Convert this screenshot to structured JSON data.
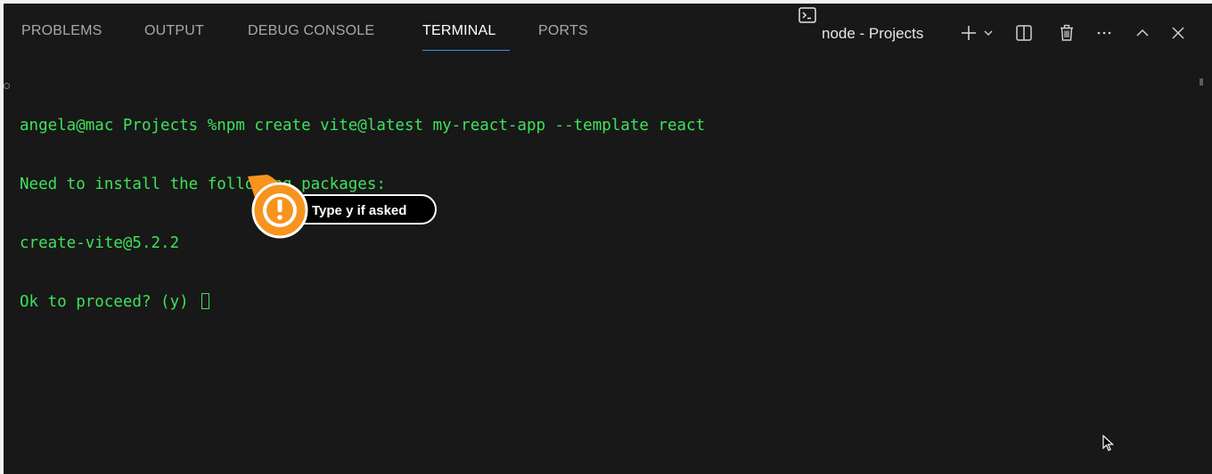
{
  "tabs": [
    {
      "label": "PROBLEMS",
      "active": false
    },
    {
      "label": "OUTPUT",
      "active": false
    },
    {
      "label": "DEBUG CONSOLE",
      "active": false
    },
    {
      "label": "TERMINAL",
      "active": true
    },
    {
      "label": "PORTS",
      "active": false
    }
  ],
  "toolbar": {
    "terminal_name": "node - Projects",
    "icons": [
      "terminal-icon",
      "plus-icon",
      "chevron-down-icon",
      "split-icon",
      "trash-icon",
      "more-icon",
      "chevron-up-icon",
      "close-icon"
    ]
  },
  "terminal": {
    "lines": [
      "angela@mac Projects %npm create vite@latest my-react-app --template react",
      "Need to install the following packages:",
      "create-vite@5.2.2",
      "Ok to proceed? (y) "
    ]
  },
  "callout": {
    "text": "Type y if asked",
    "icon": "exclamation-icon"
  },
  "colors": {
    "background": "#181818",
    "terminal_text": "#3ee25a",
    "accent_underline": "#3b8eea",
    "callout_orange": "#f7941d"
  }
}
